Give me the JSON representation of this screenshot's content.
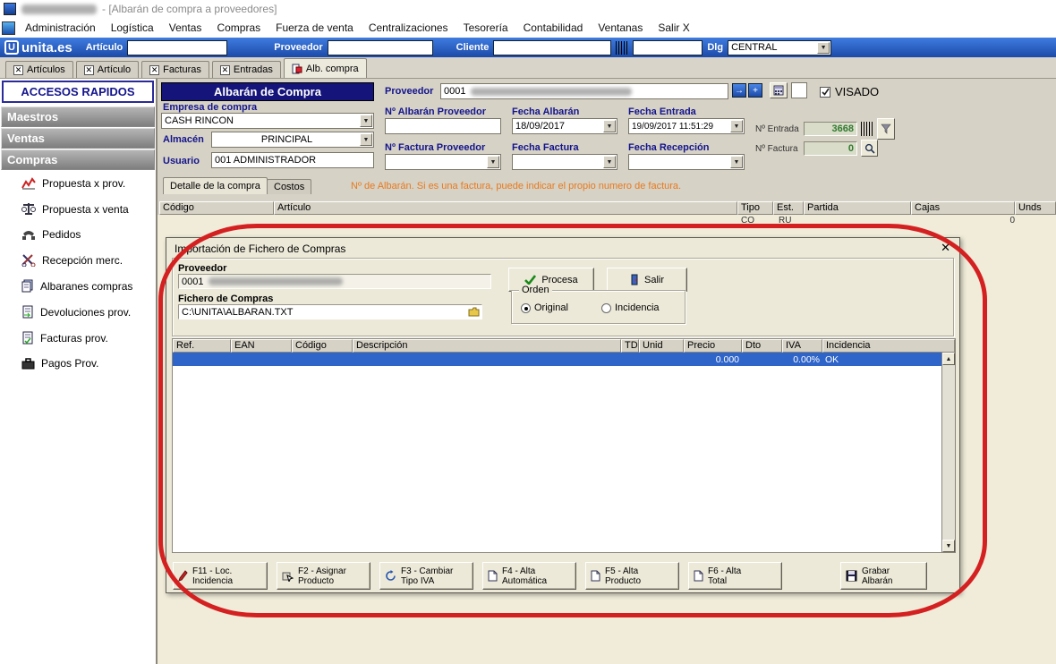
{
  "window": {
    "title_suffix": "- [Albarán de compra a proveedores]",
    "menu": [
      "Administración",
      "Logística",
      "Ventas",
      "Compras",
      "Fuerza de venta",
      "Centralizaciones",
      "Tesorería",
      "Contabilidad",
      "Ventanas",
      "Salir X"
    ]
  },
  "toolbar": {
    "logo": "unita.es",
    "articulo_label": "Artículo",
    "proveedor_label": "Proveedor",
    "cliente_label": "Cliente",
    "dlg_label": "Dlg",
    "dlg_value": "CENTRAL"
  },
  "tabs": {
    "items": [
      "Artículos",
      "Artículo",
      "Facturas",
      "Entradas",
      "Alb. compra"
    ]
  },
  "sidebar": {
    "header": "ACCESOS RAPIDOS",
    "sections": [
      "Maestros",
      "Ventas",
      "Compras"
    ],
    "items": [
      "Propuesta x prov.",
      "Propuesta x venta",
      "Pedidos",
      "Recepción merc.",
      "Albaranes compras",
      "Devoluciones prov.",
      "Facturas prov.",
      "Pagos Prov."
    ]
  },
  "form": {
    "title": "Albarán de Compra",
    "empresa_label": "Empresa de compra",
    "empresa_value": "CASH RINCON",
    "almacen_label": "Almacén",
    "almacen_value": "PRINCIPAL",
    "usuario_label": "Usuario",
    "usuario_value": "001 ADMINISTRADOR",
    "proveedor_label": "Proveedor",
    "proveedor_code": "0001",
    "visado_label": "VISADO",
    "n_albaran_prov_label": "Nº Albarán Proveedor",
    "fecha_albaran_label": "Fecha Albarán",
    "fecha_albaran_value": "18/09/2017",
    "fecha_entrada_label": "Fecha Entrada",
    "fecha_entrada_value": "19/09/2017 11:51:29",
    "n_factura_prov_label": "Nº Factura Proveedor",
    "fecha_factura_label": "Fecha Factura",
    "fecha_recepcion_label": "Fecha Recepción",
    "n_entrada_label": "Nº Entrada",
    "n_entrada_value": "3668",
    "n_factura_label": "Nº Factura",
    "n_factura_value": "0",
    "detail_tab_1": "Detalle de la compra",
    "detail_tab_2": "Costos",
    "hint": "Nº de Albarán. Si es una factura, puede indicar el propio numero de factura.",
    "grid_headers": [
      "Código",
      "Artículo",
      "Tipo",
      "Est.",
      "Partida",
      "Cajas",
      "Unds"
    ],
    "row_tipo": "CO",
    "row_est": "RU",
    "row_cajas": "0"
  },
  "dialog": {
    "title": "Importación de Fichero de Compras",
    "close_glyph": "✕",
    "proveedor_label": "Proveedor",
    "proveedor_code": "0001",
    "procesa_label": "Procesa",
    "salir_label": "Salir",
    "fichero_label": "Fichero de Compras",
    "fichero_value": "C:\\UNITA\\ALBARAN.TXT",
    "orden_label": "Orden",
    "orden_original": "Original",
    "orden_incidencia": "Incidencia",
    "grid_headers": [
      "Ref.",
      "EAN",
      "Código",
      "Descripción",
      "TD",
      "Unid",
      "Precio",
      "Dto",
      "IVA",
      "Incidencia"
    ],
    "row": {
      "precio": "0.000",
      "iva": "0.00%",
      "incidencia": "OK"
    },
    "buttons": [
      {
        "line1": "F11 - Loc.",
        "line2": "Incidencia"
      },
      {
        "line1": "F2 - Asignar",
        "line2": "Producto"
      },
      {
        "line1": "F3 - Cambiar",
        "line2": "Tipo IVA"
      },
      {
        "line1": "F4 - Alta",
        "line2": "Automática"
      },
      {
        "line1": "F5 - Alta",
        "line2": "Producto"
      },
      {
        "line1": "F6 - Alta",
        "line2": "Total"
      },
      {
        "line1": "Grabar",
        "line2": "Albarán"
      }
    ]
  }
}
